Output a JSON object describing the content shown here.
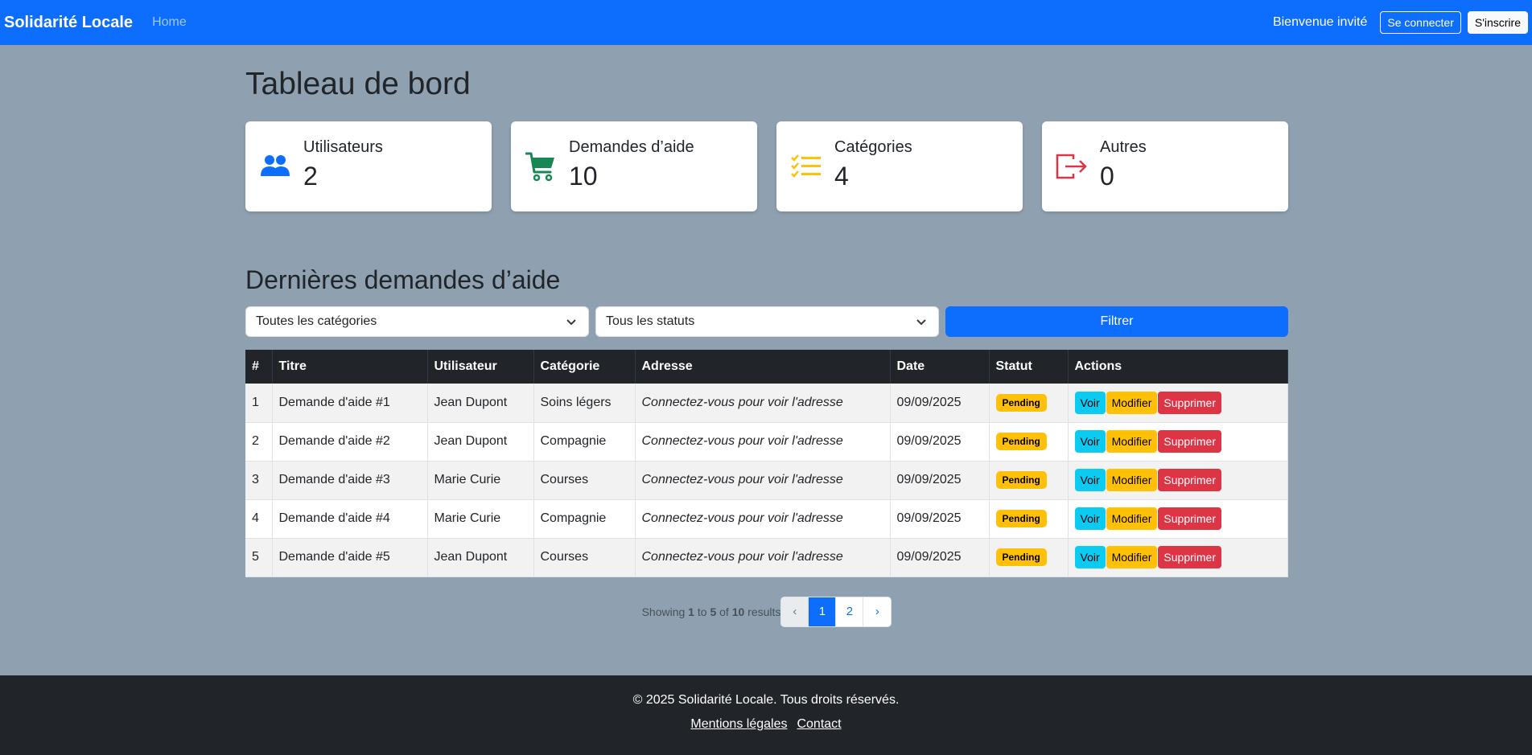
{
  "navbar": {
    "brand": "Solidarité Locale",
    "home": "Home",
    "welcome": "Bienvenue invité",
    "login": "Se connecter",
    "register": "S'inscrire"
  },
  "page_title": "Tableau de bord",
  "cards": [
    {
      "title": "Utilisateurs",
      "value": "2",
      "icon": "users-icon",
      "color": "#0d6efd"
    },
    {
      "title": "Demandes d’aide",
      "value": "10",
      "icon": "cart-icon",
      "color": "#198754"
    },
    {
      "title": "Catégories",
      "value": "4",
      "icon": "list-icon",
      "color": "#ffc107"
    },
    {
      "title": "Autres",
      "value": "0",
      "icon": "logout-icon",
      "color": "#dc3545"
    }
  ],
  "section_title": "Dernières demandes d’aide",
  "filters": {
    "category": "Toutes les catégories",
    "status": "Tous les statuts",
    "button": "Filtrer"
  },
  "table": {
    "headers": [
      "#",
      "Titre",
      "Utilisateur",
      "Catégorie",
      "Adresse",
      "Date",
      "Statut",
      "Actions"
    ],
    "rows": [
      {
        "id": "1",
        "title": "Demande d'aide #1",
        "user": "Jean Dupont",
        "category": "Soins légers",
        "address": "Connectez-vous pour voir l'adresse",
        "date": "09/09/2025",
        "status": "Pending"
      },
      {
        "id": "2",
        "title": "Demande d'aide #2",
        "user": "Jean Dupont",
        "category": "Compagnie",
        "address": "Connectez-vous pour voir l'adresse",
        "date": "09/09/2025",
        "status": "Pending"
      },
      {
        "id": "3",
        "title": "Demande d'aide #3",
        "user": "Marie Curie",
        "category": "Courses",
        "address": "Connectez-vous pour voir l'adresse",
        "date": "09/09/2025",
        "status": "Pending"
      },
      {
        "id": "4",
        "title": "Demande d'aide #4",
        "user": "Marie Curie",
        "category": "Compagnie",
        "address": "Connectez-vous pour voir l'adresse",
        "date": "09/09/2025",
        "status": "Pending"
      },
      {
        "id": "5",
        "title": "Demande d'aide #5",
        "user": "Jean Dupont",
        "category": "Courses",
        "address": "Connectez-vous pour voir l'adresse",
        "date": "09/09/2025",
        "status": "Pending"
      }
    ],
    "actions": {
      "view": "Voir",
      "edit": "Modifier",
      "delete": "Supprimer"
    }
  },
  "pagination": {
    "showing": "Showing",
    "from": "1",
    "to_word": "to",
    "to": "5",
    "of_word": "of",
    "total": "10",
    "results": "results",
    "prev": "‹",
    "pages": [
      "1",
      "2"
    ],
    "next": "›",
    "current": "1"
  },
  "footer": {
    "copyright": "© 2025 Solidarité Locale. Tous droits réservés.",
    "legal": "Mentions légales",
    "contact": "Contact"
  }
}
